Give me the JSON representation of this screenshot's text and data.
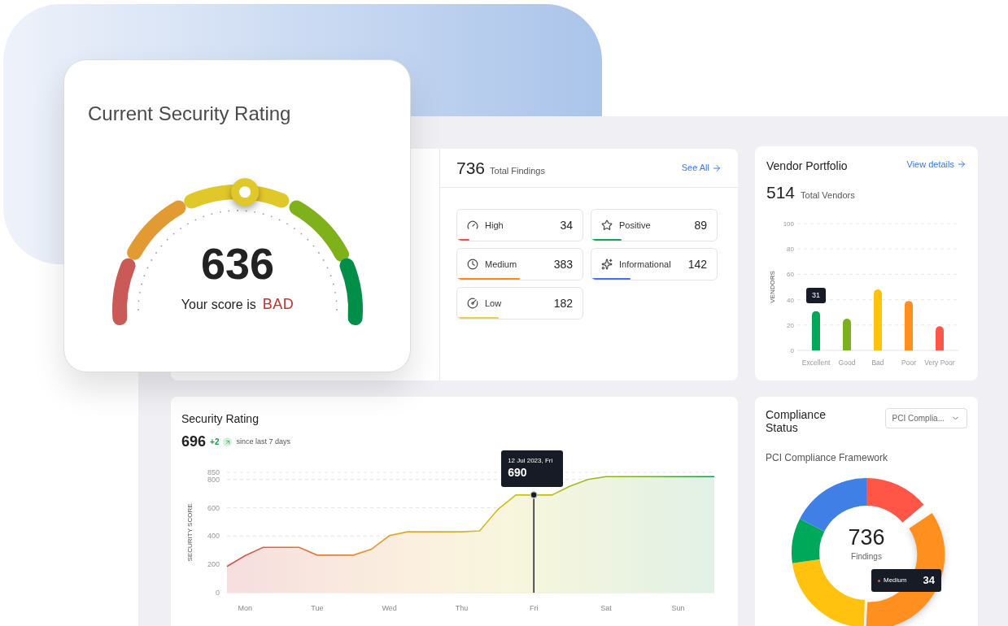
{
  "rating_card": {
    "title": "Current Security Rating",
    "score": "636",
    "caption": "Your score is",
    "verdict": "BAD",
    "level": 0.52
  },
  "findings": {
    "total": "736",
    "label": "Total Findings",
    "link": "See All",
    "items": [
      {
        "kind": "high",
        "label": "High",
        "count": "34",
        "color": "#f0504a",
        "level": 0.1
      },
      {
        "kind": "positive",
        "label": "Positive",
        "count": "89",
        "color": "#12a75a",
        "level": 0.24
      },
      {
        "kind": "medium",
        "label": "Medium",
        "count": "383",
        "color": "#f58a1f",
        "level": 0.5
      },
      {
        "kind": "informational",
        "label": "Informational",
        "count": "142",
        "color": "#3a78e6",
        "level": 0.31
      },
      {
        "kind": "low",
        "label": "Low",
        "count": "182",
        "color": "#f0cf4c",
        "level": 0.33
      }
    ]
  },
  "vendor_portfolio": {
    "title": "Vendor Portfolio",
    "link": "View details",
    "total": "514",
    "total_label": "Total Vendors",
    "chart_data": {
      "type": "bar",
      "ylabel": "VENDORS",
      "categories": [
        "Excellent",
        "Good",
        "Bad",
        "Poor",
        "Very Poor"
      ],
      "series": [
        {
          "color": "#00a85a",
          "values": [
            31,
            null,
            null,
            null,
            null
          ]
        },
        {
          "color": "#7cb01c",
          "values": [
            null,
            25,
            null,
            null,
            null
          ]
        },
        {
          "color": "#ffc20e",
          "values": [
            null,
            null,
            48,
            null,
            null
          ]
        },
        {
          "color": "#ff8f1f",
          "values": [
            null,
            null,
            null,
            39,
            null
          ]
        },
        {
          "color": "#ff5647",
          "values": [
            null,
            null,
            null,
            null,
            19
          ]
        }
      ],
      "stacked": true,
      "grid": true,
      "ylim": [
        0,
        100
      ],
      "yticks": [
        0,
        20,
        40,
        60,
        80,
        100
      ],
      "annotations": [
        {
          "x": "Excellent",
          "text": "31"
        }
      ]
    }
  },
  "security_rating": {
    "title": "Security Rating",
    "score": "696",
    "delta": "+2",
    "since": "since last 7 days",
    "tooltip": {
      "date": "12 Jul 2023, Fri"
    },
    "chart_data": {
      "type": "area",
      "ylabel": "SECURITY SCORE",
      "grid": true,
      "categories": [
        null,
        "Mon",
        null,
        null,
        null,
        "Tue",
        null,
        null,
        null,
        "Wed",
        null,
        null,
        null,
        "Thu",
        null,
        null,
        null,
        "Fri",
        null,
        null,
        null,
        "Sat",
        null,
        null,
        null,
        "Sun",
        null,
        null
      ],
      "series": [
        {
          "color": "#c9c21f",
          "values": [
            185,
            261,
            320,
            320,
            320,
            265,
            265,
            265,
            307,
            403,
            430,
            430,
            430,
            430,
            436,
            587,
            690,
            690,
            690,
            752,
            800,
            820,
            820,
            820,
            820,
            820,
            820,
            820
          ]
        }
      ],
      "ylim": [
        0,
        850
      ],
      "yticks": [
        0,
        200,
        400,
        600,
        800,
        850
      ],
      "annotations": [
        {
          "x": "Fri",
          "y": 690,
          "text": "690"
        }
      ]
    }
  },
  "compliance": {
    "title": "Compliance Status",
    "dropdown": "PCI Complia...",
    "subtitle": "PCI Compliance Framework",
    "total": "736",
    "total_label": "Findings",
    "tooltip": {
      "label": "Medium",
      "value": "34"
    }
  }
}
